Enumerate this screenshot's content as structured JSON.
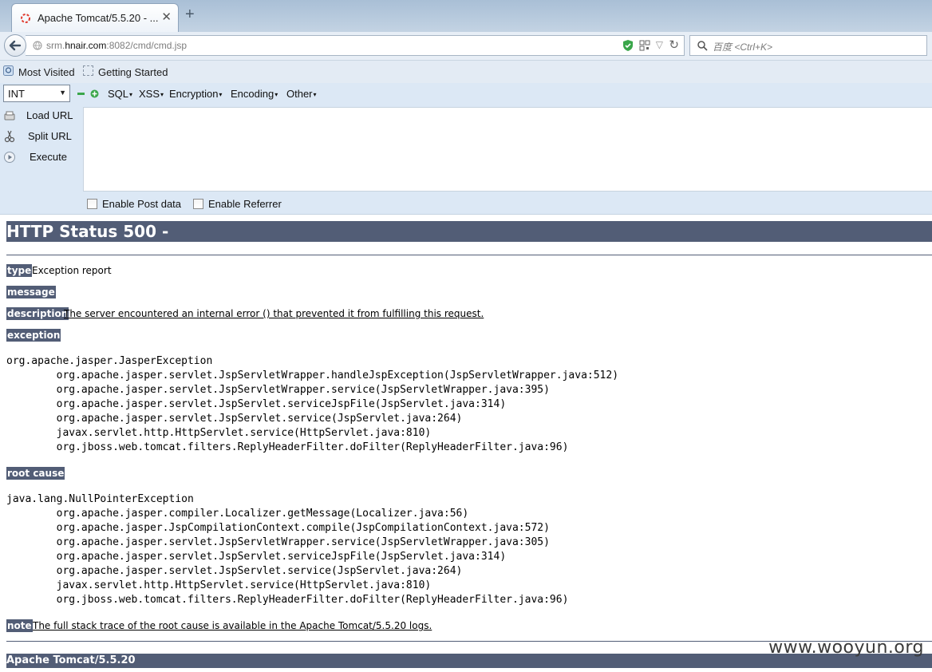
{
  "browser": {
    "tab_title": "Apache Tomcat/5.5.20 - ...",
    "tab_close": "✕",
    "new_tab": "+",
    "url_prefix": "srm.",
    "url_domain": "hnair.com",
    "url_suffix": ":8082/cmd/cmd.jsp",
    "search_placeholder": "百度 <Ctrl+K>"
  },
  "bookmarks": {
    "most_visited": "Most Visited",
    "getting_started": "Getting Started"
  },
  "hackbar": {
    "select_value": "INT",
    "menus": [
      "SQL",
      "XSS",
      "Encryption",
      "Encoding",
      "Other"
    ],
    "actions": [
      "Load URL",
      "Split URL",
      "Execute"
    ],
    "enable_post": "Enable Post data",
    "enable_referrer": "Enable Referrer"
  },
  "page": {
    "heading": "HTTP Status 500 -",
    "type_label": "type",
    "type_value": "Exception report",
    "message_label": "message",
    "description_label": "description",
    "description_value": "The server encountered an internal error () that prevented it from fulfilling this request.",
    "exception_label": "exception",
    "exception_trace": "org.apache.jasper.JasperException\n\torg.apache.jasper.servlet.JspServletWrapper.handleJspException(JspServletWrapper.java:512)\n\torg.apache.jasper.servlet.JspServletWrapper.service(JspServletWrapper.java:395)\n\torg.apache.jasper.servlet.JspServlet.serviceJspFile(JspServlet.java:314)\n\torg.apache.jasper.servlet.JspServlet.service(JspServlet.java:264)\n\tjavax.servlet.http.HttpServlet.service(HttpServlet.java:810)\n\torg.jboss.web.tomcat.filters.ReplyHeaderFilter.doFilter(ReplyHeaderFilter.java:96)",
    "root_cause_label": "root cause",
    "root_cause_trace": "java.lang.NullPointerException\n\torg.apache.jasper.compiler.Localizer.getMessage(Localizer.java:56)\n\torg.apache.jasper.JspCompilationContext.compile(JspCompilationContext.java:572)\n\torg.apache.jasper.servlet.JspServletWrapper.service(JspServletWrapper.java:305)\n\torg.apache.jasper.servlet.JspServlet.serviceJspFile(JspServlet.java:314)\n\torg.apache.jasper.servlet.JspServlet.service(JspServlet.java:264)\n\tjavax.servlet.http.HttpServlet.service(HttpServlet.java:810)\n\torg.jboss.web.tomcat.filters.ReplyHeaderFilter.doFilter(ReplyHeaderFilter.java:96)",
    "note_label": "note",
    "note_value": "The full stack trace of the root cause is available in the Apache Tomcat/5.5.20 logs.",
    "footer": "Apache Tomcat/5.5.20"
  },
  "watermark": "www.wooyun.org",
  "colors": {
    "tomcat_header": "#525d76",
    "hackbar_bg": "#dce8f5",
    "shield_green": "#3aa64a"
  }
}
